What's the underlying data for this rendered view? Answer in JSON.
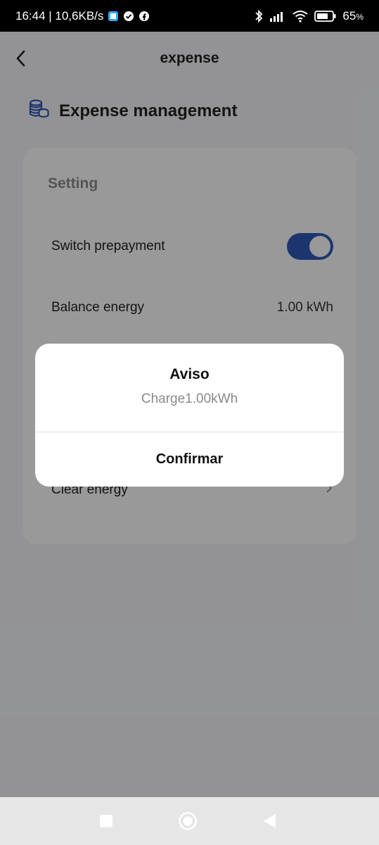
{
  "status_bar": {
    "time_speed": "16:44 | 10,6KB/s",
    "battery": "65"
  },
  "app_bar": {
    "title": "expense"
  },
  "section": {
    "title": "Expense management"
  },
  "card": {
    "subtitle": "Setting",
    "rows": [
      {
        "label": "Switch prepayment",
        "toggle_on": true
      },
      {
        "label": "Balance energy",
        "value": "1.00 kWh"
      },
      {
        "label": "Clear energy"
      }
    ]
  },
  "dialog": {
    "title": "Aviso",
    "message": "Charge1.00kWh",
    "button": "Confirmar"
  },
  "colors": {
    "accent": "#2e5bb8",
    "overlay": "rgba(0,0,0,0.40)"
  },
  "icons": [
    "wifi-icon",
    "bluetooth-icon",
    "signal-icon",
    "battery-icon",
    "back-arrow-icon",
    "coins-icon",
    "chevron-right-icon",
    "square-nav-icon",
    "home-nav-icon",
    "triangle-back-icon"
  ]
}
